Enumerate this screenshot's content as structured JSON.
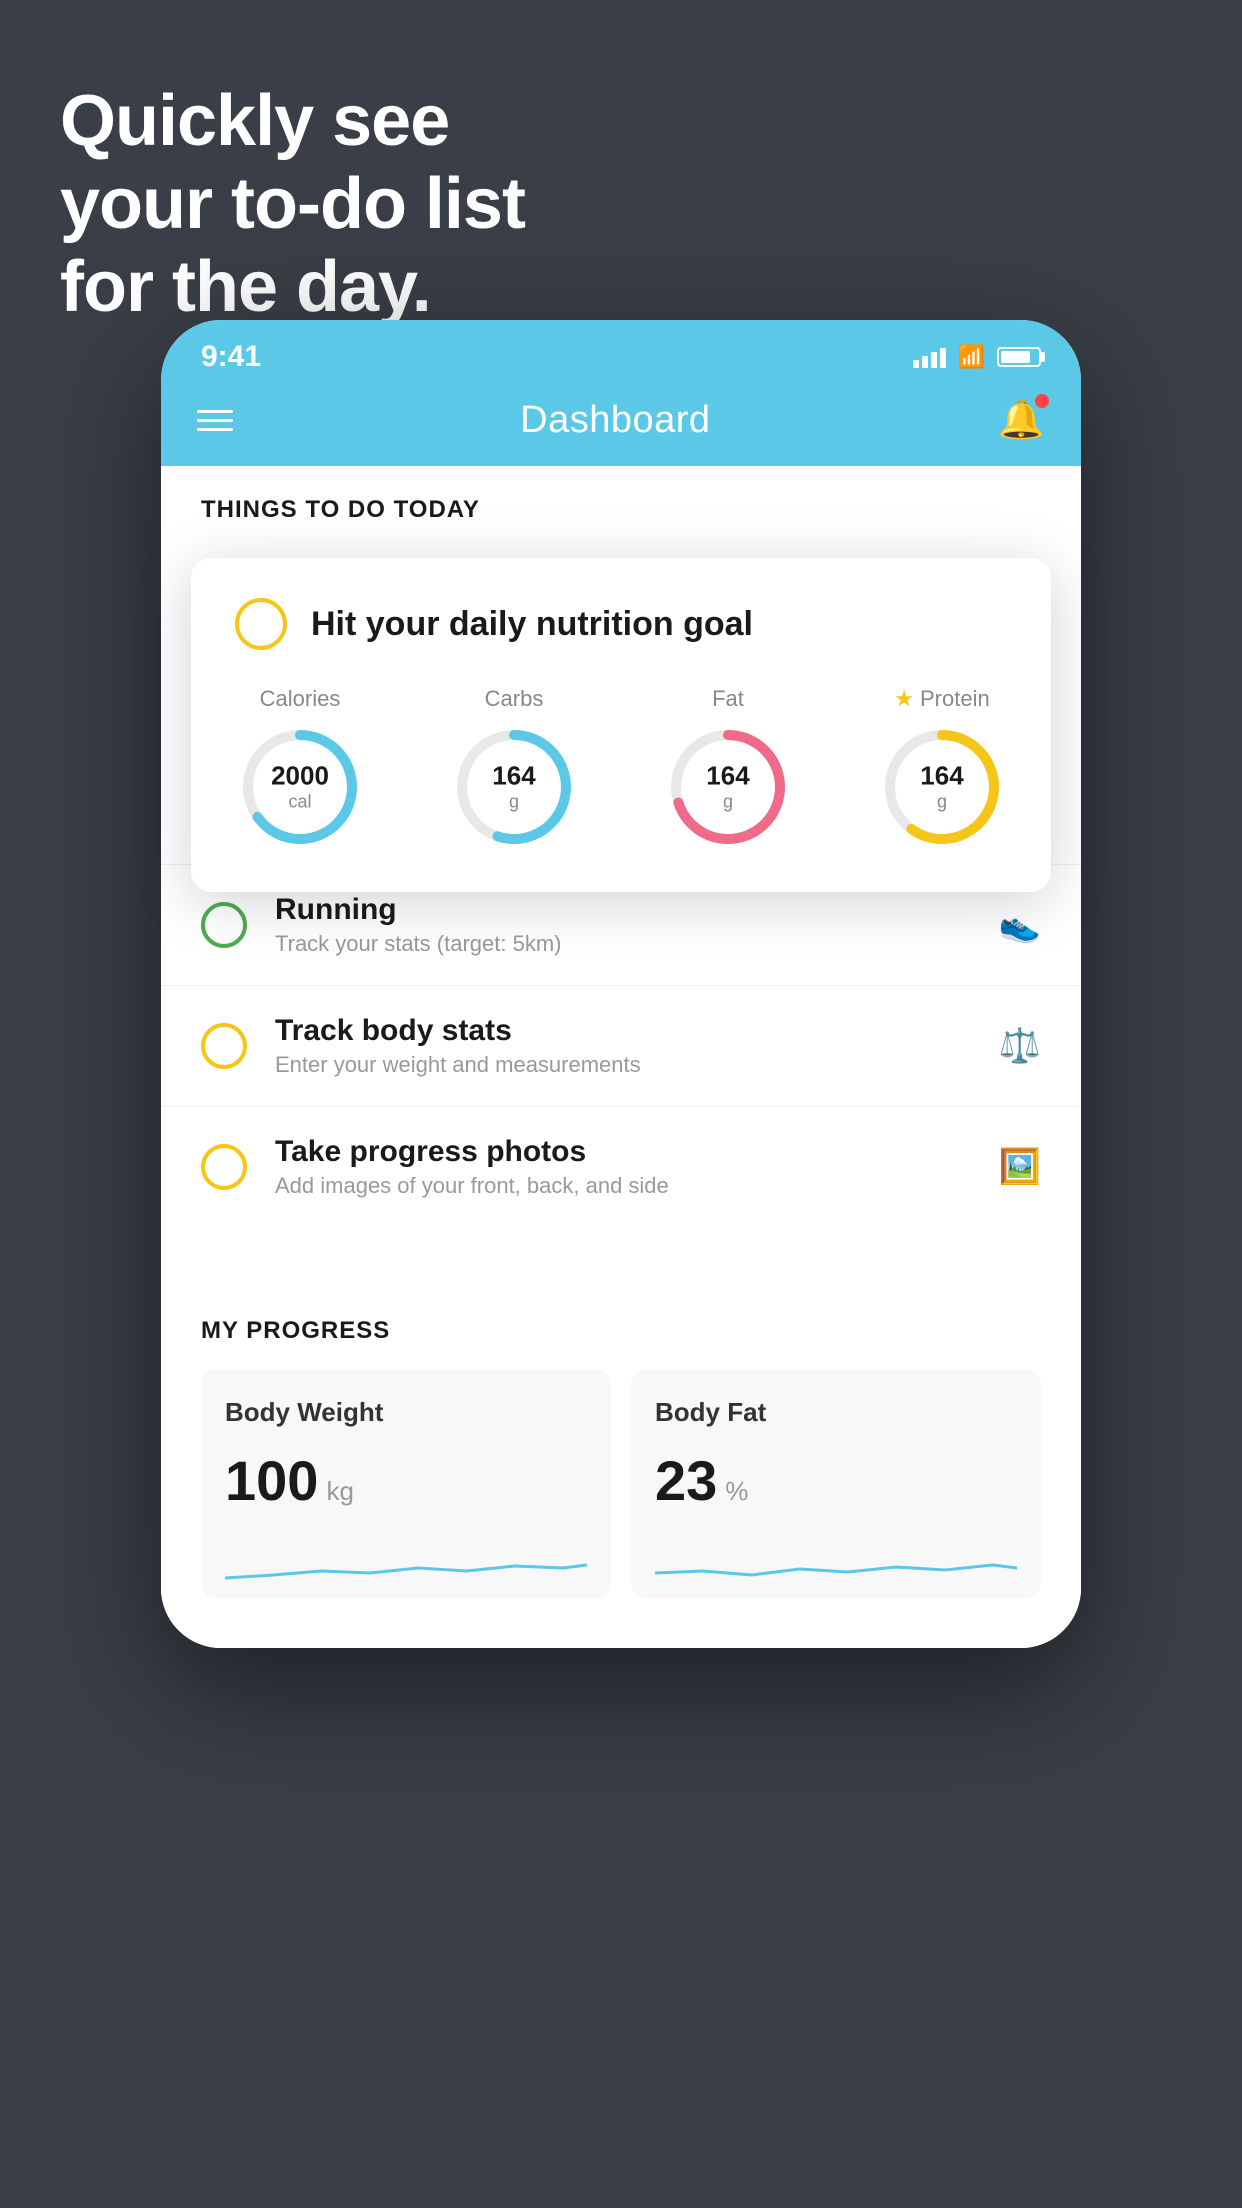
{
  "headline": {
    "line1": "Quickly see",
    "line2": "your to-do list",
    "line3": "for the day."
  },
  "statusBar": {
    "time": "9:41"
  },
  "header": {
    "title": "Dashboard"
  },
  "thingsToDoSection": {
    "sectionTitle": "THINGS TO DO TODAY"
  },
  "nutritionCard": {
    "title": "Hit your daily nutrition goal",
    "items": [
      {
        "label": "Calories",
        "value": "2000",
        "unit": "cal",
        "color": "#5bc8e8",
        "percent": 65
      },
      {
        "label": "Carbs",
        "value": "164",
        "unit": "g",
        "color": "#5bc8e8",
        "percent": 55
      },
      {
        "label": "Fat",
        "value": "164",
        "unit": "g",
        "color": "#f06a8a",
        "percent": 70
      },
      {
        "label": "Protein",
        "value": "164",
        "unit": "g",
        "color": "#f5c518",
        "percent": 60,
        "star": true
      }
    ]
  },
  "todoItems": [
    {
      "id": "running",
      "title": "Running",
      "sub": "Track your stats (target: 5km)",
      "circleColor": "green",
      "icon": "👟"
    },
    {
      "id": "body-stats",
      "title": "Track body stats",
      "sub": "Enter your weight and measurements",
      "circleColor": "yellow",
      "icon": "⚖️"
    },
    {
      "id": "photos",
      "title": "Take progress photos",
      "sub": "Add images of your front, back, and side",
      "circleColor": "yellow",
      "icon": "🖼️"
    }
  ],
  "progressSection": {
    "title": "MY PROGRESS",
    "cards": [
      {
        "id": "body-weight",
        "title": "Body Weight",
        "value": "100",
        "unit": "kg"
      },
      {
        "id": "body-fat",
        "title": "Body Fat",
        "value": "23",
        "unit": "%"
      }
    ]
  }
}
